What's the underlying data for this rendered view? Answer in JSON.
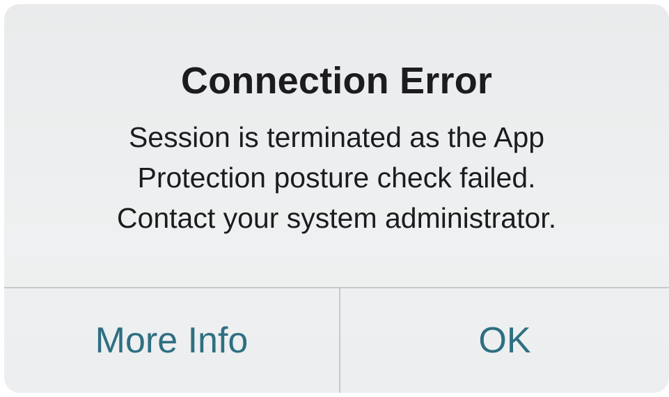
{
  "alert": {
    "title": "Connection Error",
    "message_lines": [
      "Session is terminated as the App",
      "Protection posture check failed.",
      "Contact your system administrator."
    ],
    "buttons": {
      "more_info": "More Info",
      "ok": "OK"
    }
  },
  "colors": {
    "background": "#eceeef",
    "text": "#1c1c1e",
    "button_text": "#2e6f82",
    "divider": "#c6c8ca"
  }
}
